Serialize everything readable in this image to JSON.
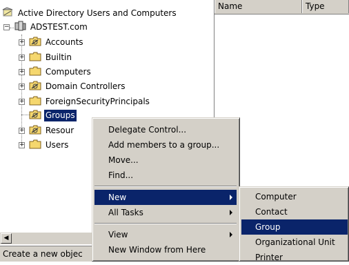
{
  "tree": {
    "root": {
      "label": "Active Directory Users and Computers",
      "icon": "ad-snapin-icon"
    },
    "domain": {
      "label": "ADSTEST.com",
      "icon": "domain-icon"
    },
    "items": [
      {
        "label": "Accounts",
        "icon": "ou-folder-icon"
      },
      {
        "label": "Builtin",
        "icon": "folder-icon"
      },
      {
        "label": "Computers",
        "icon": "folder-icon"
      },
      {
        "label": "Domain Controllers",
        "icon": "ou-folder-icon"
      },
      {
        "label": "ForeignSecurityPrincipals",
        "icon": "folder-icon"
      },
      {
        "label": "Groups",
        "icon": "ou-folder-icon",
        "selected": true
      },
      {
        "label": "Resour",
        "icon": "ou-folder-icon"
      },
      {
        "label": "Users",
        "icon": "folder-icon"
      }
    ]
  },
  "list": {
    "columns": [
      "Name",
      "Type"
    ]
  },
  "status": {
    "text": "Create a new objec"
  },
  "context_menu": {
    "items": [
      "Delegate Control...",
      "Add members to a group...",
      "Move...",
      "Find..."
    ],
    "new_label": "New",
    "all_tasks_label": "All Tasks",
    "view_label": "View",
    "new_window_label": "New Window from Here"
  },
  "submenu": {
    "items": [
      "Computer",
      "Contact",
      "Group",
      "Organizational Unit",
      "Printer"
    ],
    "highlighted": "Group"
  },
  "colors": {
    "selection": "#0a246a",
    "menu_bg": "#d4d0c8",
    "folder": "#f5d76e"
  }
}
